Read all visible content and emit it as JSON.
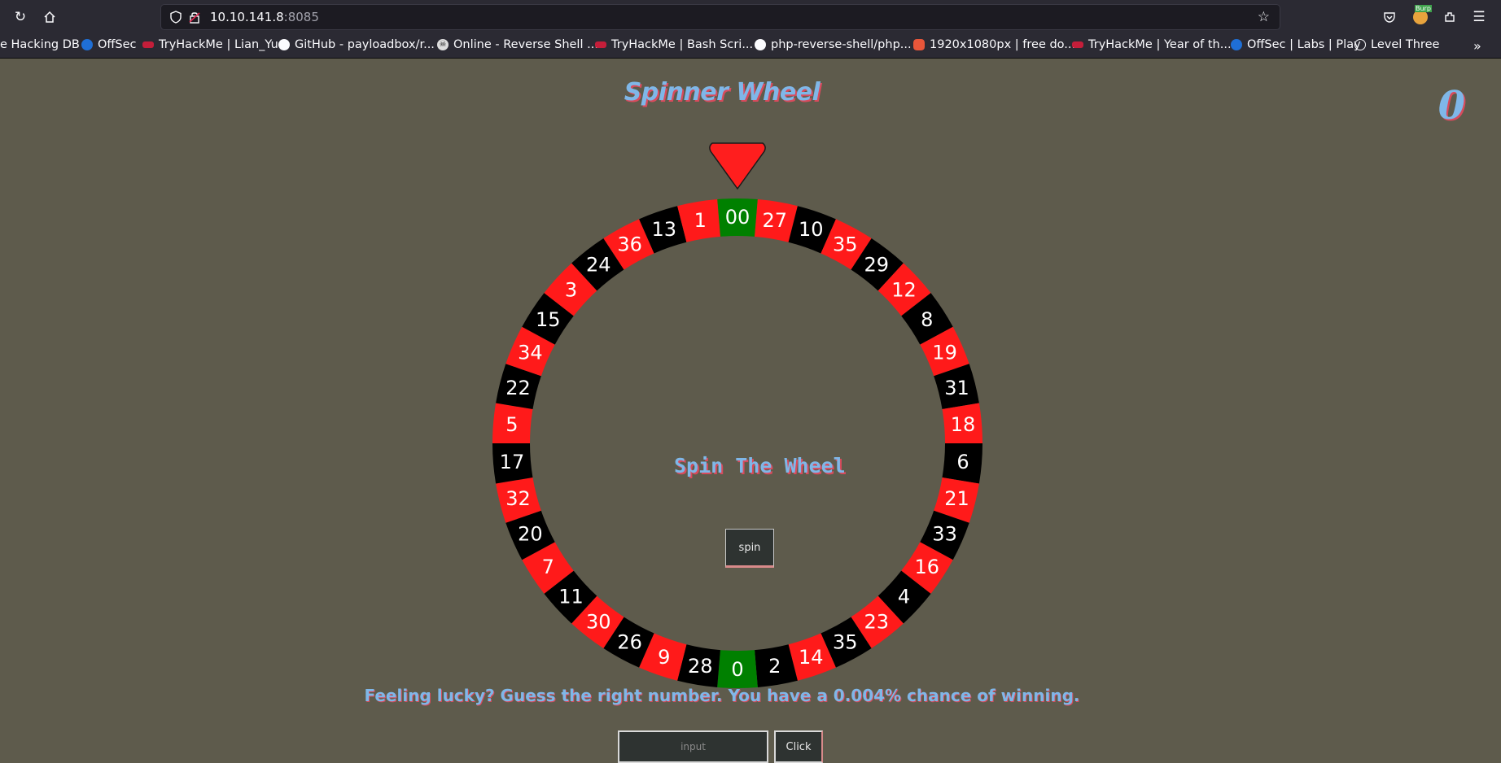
{
  "browser": {
    "url_host": "10.10.141.8",
    "url_port": ":8085",
    "bookmarks": [
      {
        "label": "e Hacking DB",
        "icon": "bookmark-icon"
      },
      {
        "label": "OffSec",
        "icon": "offsec-icon"
      },
      {
        "label": "TryHackMe | Lian_Yu",
        "icon": "tryhackme-icon"
      },
      {
        "label": "GitHub - payloadbox/r...",
        "icon": "github-icon"
      },
      {
        "label": "Online - Reverse Shell ...",
        "icon": "skull-icon"
      },
      {
        "label": "TryHackMe | Bash Scri...",
        "icon": "tryhackme-icon"
      },
      {
        "label": "php-reverse-shell/php...",
        "icon": "github-icon"
      },
      {
        "label": "1920x1080px | free do...",
        "icon": "flame-icon"
      },
      {
        "label": "TryHackMe | Year of th...",
        "icon": "tryhackme-icon"
      },
      {
        "label": "OffSec | Labs | Play",
        "icon": "offsec-icon"
      },
      {
        "label": "Level Three",
        "icon": "globe-icon"
      }
    ],
    "extension_badge": "Burp"
  },
  "page": {
    "title": "Spinner Wheel",
    "score": "0",
    "wheel_caption": "Spin The Wheel",
    "spin_label": "spin",
    "lucky_text": "Feeling lucky? Guess the right number. You have a 0.004% chance of winning.",
    "input_placeholder": "input",
    "click_label": "Click"
  },
  "wheel": {
    "pockets": [
      "00",
      "27",
      "10",
      "35",
      "29",
      "12",
      "8",
      "19",
      "31",
      "18",
      "6",
      "21",
      "33",
      "16",
      "4",
      "23",
      "35",
      "14",
      "2",
      "0",
      "28",
      "9",
      "26",
      "30",
      "11",
      "7",
      "20",
      "32",
      "17",
      "5",
      "22",
      "34",
      "15",
      "3",
      "24",
      "36",
      "13",
      "1"
    ],
    "colors": [
      "green",
      "red",
      "black",
      "red",
      "black",
      "red",
      "black",
      "red",
      "black",
      "red",
      "black",
      "red",
      "black",
      "red",
      "black",
      "red",
      "black",
      "red",
      "black",
      "green",
      "black",
      "red",
      "black",
      "red",
      "black",
      "red",
      "black",
      "red",
      "black",
      "red",
      "black",
      "red",
      "black",
      "red",
      "black",
      "red",
      "black",
      "red"
    ],
    "palette": {
      "red": "#ff1a1a",
      "black": "#000000",
      "green": "#008000",
      "pointer": "#ff1e1e"
    }
  }
}
